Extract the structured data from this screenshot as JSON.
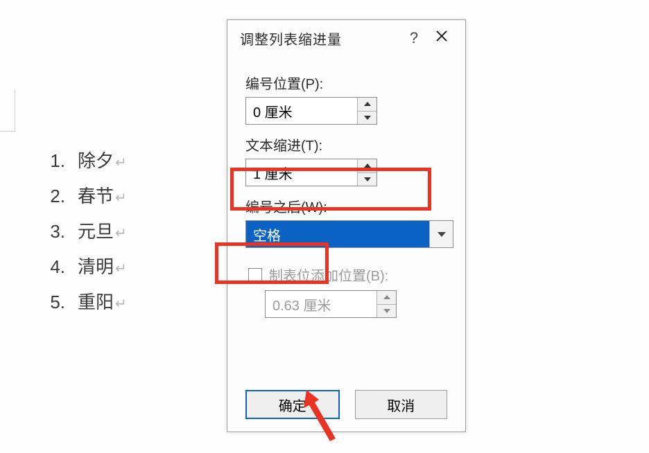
{
  "list": {
    "items": [
      {
        "num": "1.",
        "text": "除夕"
      },
      {
        "num": "2.",
        "text": "春节"
      },
      {
        "num": "3.",
        "text": "元旦"
      },
      {
        "num": "4.",
        "text": "清明"
      },
      {
        "num": "5.",
        "text": "重阳"
      }
    ],
    "return_mark": "↵"
  },
  "dialog": {
    "title": "调整列表缩进量",
    "help": "?",
    "labels": {
      "number_position": "编号位置(P):",
      "text_indent": "文本缩进(T):",
      "after_number": "编号之后(W):",
      "tabstop": "制表位添加位置(B):"
    },
    "values": {
      "number_position": "0 厘米",
      "text_indent": "1 厘米",
      "after_number_selected": "空格",
      "tabstop": "0.63 厘米"
    },
    "buttons": {
      "ok": "确定",
      "cancel": "取消"
    },
    "tabstop_checked": false
  }
}
